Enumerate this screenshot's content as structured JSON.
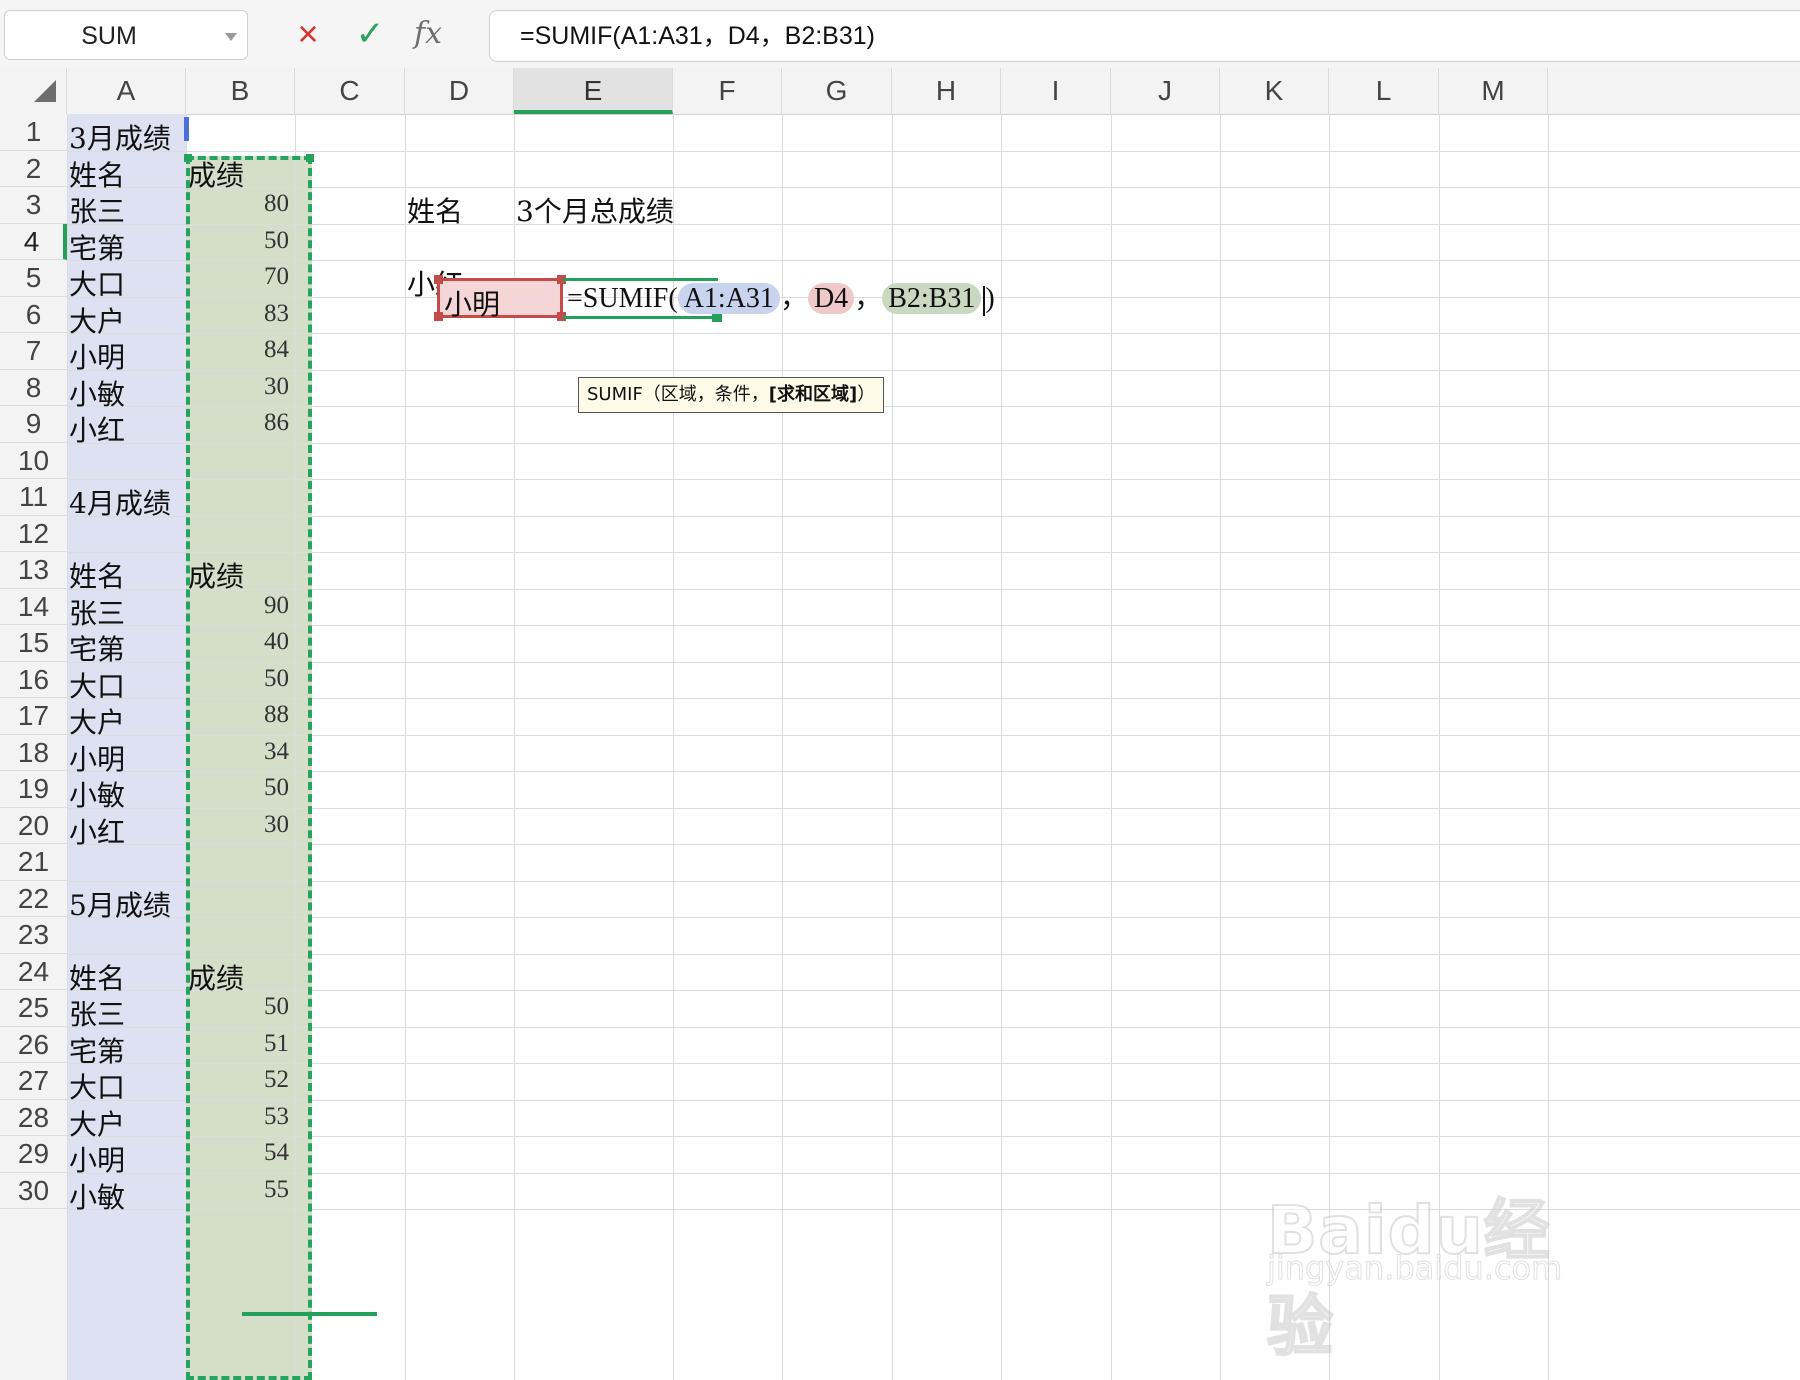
{
  "formula_bar": {
    "name_box": "SUM",
    "formula": "=SUMIF(A1:A31，D4，B2:B31)",
    "cancel_icon": "×",
    "confirm_icon": "✓",
    "fx_label": "fx"
  },
  "columns": [
    "A",
    "B",
    "C",
    "D",
    "E",
    "F",
    "G",
    "H",
    "I",
    "J",
    "K",
    "L",
    "M"
  ],
  "active_column": "E",
  "rows": [
    "1",
    "2",
    "3",
    "4",
    "5",
    "6",
    "7",
    "8",
    "9",
    "10",
    "11",
    "12",
    "13",
    "14",
    "15",
    "16",
    "17",
    "18",
    "19",
    "20",
    "21",
    "22",
    "23",
    "24",
    "25",
    "26",
    "27",
    "28",
    "29",
    "30"
  ],
  "active_row": "4",
  "cells": {
    "A1": "3月成绩",
    "A2": "姓名",
    "B2": "成绩",
    "A3": "张三",
    "B3": "80",
    "A4": "宅第",
    "B4": "50",
    "A5": "大口",
    "B5": "70",
    "A6": "大户",
    "B6": "83",
    "A7": "小明",
    "B7": "84",
    "A8": "小敏",
    "B8": "30",
    "A9": "小红",
    "B9": "86",
    "A11": "4月成绩",
    "A13": "姓名",
    "B13": "成绩",
    "A14": "张三",
    "B14": "90",
    "A15": "宅第",
    "B15": "40",
    "A16": "大口",
    "B16": "50",
    "A17": "大户",
    "B17": "88",
    "A18": "小明",
    "B18": "34",
    "A19": "小敏",
    "B19": "50",
    "A20": "小红",
    "B20": "30",
    "A22": "5月成绩",
    "A24": "姓名",
    "B24": "成绩",
    "A25": "张三",
    "B25": "50",
    "A26": "宅第",
    "B26": "51",
    "A27": "大口",
    "B27": "52",
    "A28": "大户",
    "B28": "53",
    "A29": "小明",
    "B29": "54",
    "A30": "小敏",
    "B30": "55",
    "D3": "姓名",
    "E3": "3个月总成绩",
    "D4": "小明",
    "D5": "小红"
  },
  "editor": {
    "prefix": "=SUMIF(",
    "ref1": "A1:A31",
    "sep1": "，",
    "ref2": "D4",
    "sep2": "，",
    "ref3": "B2:B31",
    "suffix": ")"
  },
  "tooltip": {
    "func": "SUMIF（区域，条件，",
    "optional": "[求和区域]",
    "close": "）"
  },
  "watermark": {
    "main": "Baidu经验",
    "sub": "jingyan.baidu.com"
  },
  "colors": {
    "selection_green": "#23a15a",
    "range_blue": "#dde1f2",
    "range_green": "#d4dec8",
    "criteria_red": "#c54a4a"
  }
}
